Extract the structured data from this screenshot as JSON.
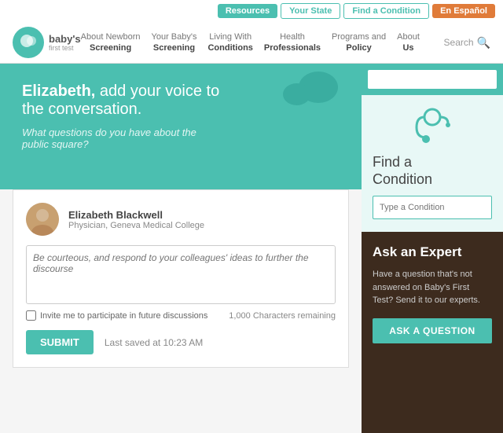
{
  "topbar": {
    "btn_resources": "Resources",
    "btn_your_state": "Your State",
    "btn_find_condition": "Find a Condition",
    "btn_espanol": "En Español"
  },
  "nav": {
    "logo_name": "baby's",
    "logo_sub": "first test",
    "items": [
      {
        "top": "About Newborn",
        "bottom": "Screening"
      },
      {
        "top": "Your Baby's",
        "bottom": "Screening"
      },
      {
        "top": "Living With",
        "bottom": "Conditions"
      },
      {
        "top": "Health",
        "bottom": "Professionals"
      },
      {
        "top": "Programs and",
        "bottom": "Policy"
      },
      {
        "top": "About",
        "bottom": "Us"
      }
    ],
    "search_label": "Search"
  },
  "hero": {
    "greeting": "Elizabeth,",
    "headline": " add your voice to the conversation.",
    "subtitle": "What questions do you have about the public square?"
  },
  "form": {
    "user_name": "Elizabeth Blackwell",
    "user_title": "Physician, Geneva Medical College",
    "textarea_placeholder": "Be courteous, and respond to your colleagues' ideas to further the discourse",
    "checkbox_label": "Invite me to participate in future discussions",
    "char_count": "1,000 Characters remaining",
    "submit_label": "SUBMIT",
    "saved_text": "Last saved at 10:23 AM"
  },
  "sidebar": {
    "search_placeholder": "",
    "find_title": "Find a\nCondition",
    "condition_placeholder": "Type a Condition",
    "ask_expert_title": "Ask an Expert",
    "ask_expert_text": "Have a question that's not answered on Baby's First Test? Send it to our experts.",
    "ask_btn_label": "ASK A QUESTION"
  }
}
